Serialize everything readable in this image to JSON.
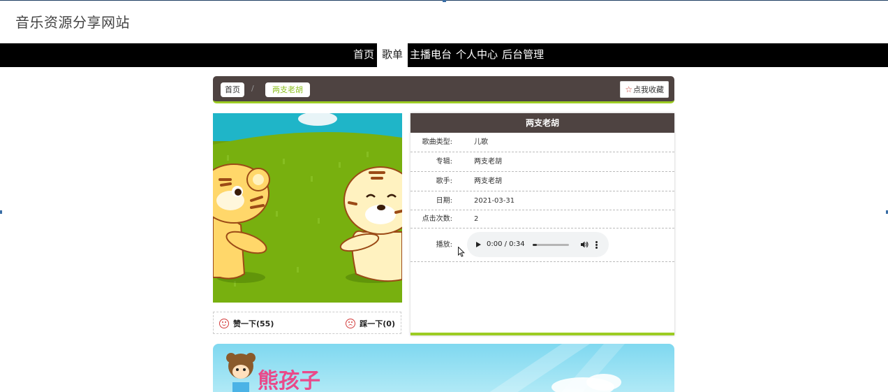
{
  "site": {
    "title": "音乐资源分享网站"
  },
  "nav": {
    "items": [
      {
        "label": "首页",
        "active": false
      },
      {
        "label": "歌单",
        "active": true
      },
      {
        "label": "主播电台",
        "active": false
      },
      {
        "label": "个人中心",
        "active": false
      },
      {
        "label": "后台管理",
        "active": false
      }
    ]
  },
  "breadcrumb": {
    "home": "首页",
    "separator": "/",
    "current": "两支老胡"
  },
  "favorite": {
    "label": "点我收藏",
    "icon": "star-icon"
  },
  "song": {
    "title": "两支老胡",
    "fields": [
      {
        "label": "歌曲类型:",
        "value": "儿歌"
      },
      {
        "label": "专辑:",
        "value": "两支老胡"
      },
      {
        "label": "歌手:",
        "value": "两支老胡"
      },
      {
        "label": "日期:",
        "value": "2021-03-31"
      },
      {
        "label": "点击次数:",
        "value": "2"
      }
    ],
    "play_label": "播放:",
    "player": {
      "time": "0:00 / 0:34",
      "progress": 0.0
    }
  },
  "votes": {
    "up_label": "赞一下(55)",
    "down_label": "踩一下(0)"
  },
  "banner": {
    "logo_text": "熊孩子"
  },
  "colors": {
    "accent": "#9ccc23",
    "dark": "#4e4341",
    "nav_bg": "#000000"
  }
}
